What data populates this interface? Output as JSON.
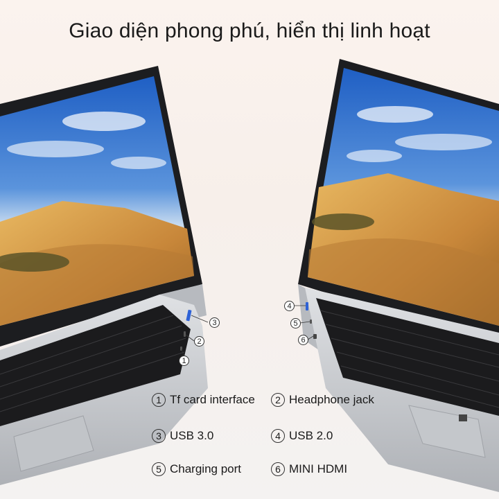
{
  "title": "Giao diện phong phú, hiển thị linh hoạt",
  "callouts": {
    "c1": "1",
    "c2": "2",
    "c3": "3",
    "c4": "4",
    "c5": "5",
    "c6": "6"
  },
  "specs": [
    {
      "num": "1",
      "label": "Tf card interface"
    },
    {
      "num": "2",
      "label": "Headphone jack"
    },
    {
      "num": "3",
      "label": "USB 3.0"
    },
    {
      "num": "4",
      "label": "USB 2.0"
    },
    {
      "num": "5",
      "label": "Charging port"
    },
    {
      "num": "6",
      "label": "MINI HDMI"
    }
  ],
  "colors": {
    "sky": "#2f6fd0",
    "sand": "#d9a24a",
    "laptop_body": "#c9cbcf",
    "keyboard": "#1b1b1d",
    "port_blue": "#2e62d6"
  }
}
